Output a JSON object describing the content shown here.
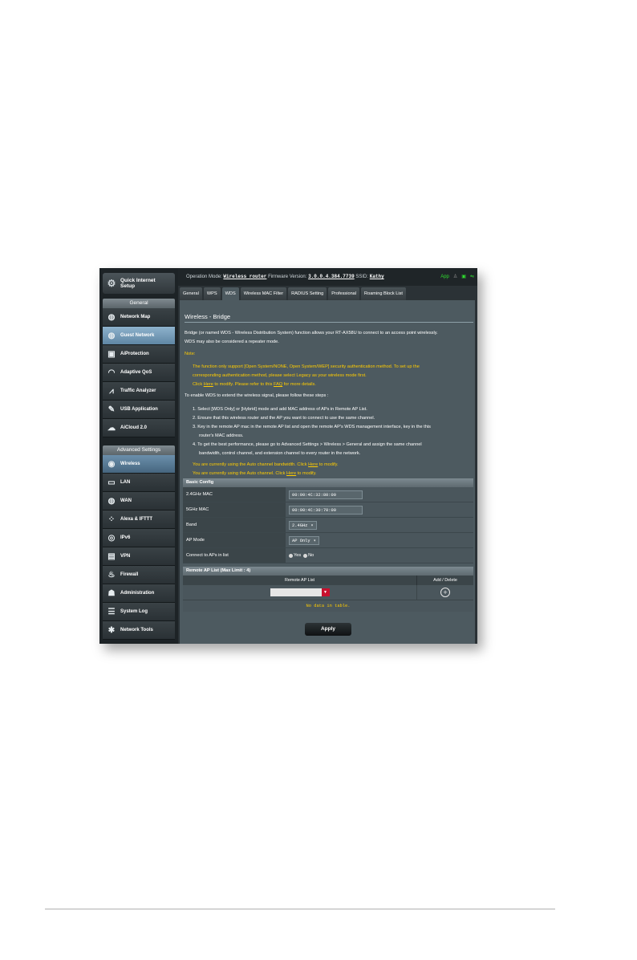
{
  "top_bar": {
    "operation_mode_label": "Operation Mode:",
    "operation_mode_value": "Wireless router",
    "firmware_label": "Firmware Version:",
    "firmware_value": "3.0.0.4.384.7739",
    "ssid_label": "SSID:",
    "ssid_value": "Kathy",
    "app_label": "App"
  },
  "sidebar": {
    "quick_setup": "Quick Internet Setup",
    "general_header": "General",
    "general_items": [
      "Network Map",
      "Guest Network",
      "AiProtection",
      "Adaptive QoS",
      "Traffic Analyzer",
      "USB Application",
      "AiCloud 2.0"
    ],
    "advanced_header": "Advanced Settings",
    "advanced_items": [
      "Wireless",
      "LAN",
      "WAN",
      "Alexa & IFTTT",
      "IPv6",
      "VPN",
      "Firewall",
      "Administration",
      "System Log",
      "Network Tools"
    ]
  },
  "tabs": [
    "General",
    "WPS",
    "WDS",
    "Wireless MAC Filter",
    "RADIUS Setting",
    "Professional",
    "Roaming Block List"
  ],
  "page": {
    "title": "Wireless - Bridge",
    "intro_1": "Bridge (or named WDS - Wireless Distribution System) function allows your RT-AX58U to connect to an access point wirelessly.",
    "intro_2": "WDS may also be considered a repeater mode.",
    "note_label": "Note:",
    "note_1": "The function only support [Open System/NONE, Open System/WEP] security authentication method. To set up the",
    "note_2": "corresponding authentication method, please select Legacy as your wireless mode first.",
    "note_3a": "Click",
    "note_3_link1": "Here",
    "note_3b": "to modify. Please refer to this",
    "note_3_link2": "FAQ",
    "note_3c": "for more details.",
    "steps_intro": "To enable WDS to extend the wireless signal, please follow these steps :",
    "step_1": "1. Select [WDS Only] or [Hybrid] mode and add MAC address of APs in Remote AP List.",
    "step_2": "2. Ensure that this wireless router and the AP you want to connect to use the same channel.",
    "step_3a": "3. Key in the remote AP mac in the remote AP list and open the remote AP's WDS management interface, key in the this",
    "step_3b": "router's MAC address.",
    "step_4a": "4. To get the best performance, please go to Advanced Settings > Wireless > General and assign the same channel",
    "step_4b": "bandwidth, control channel, and extension channel to every router in the network.",
    "auto_bw_a": "You are currently using the Auto channel bandwidth. Click",
    "auto_bw_link": "Here",
    "auto_bw_b": "to modify.",
    "auto_ch_a": "You are currently using the Auto channel. Click",
    "auto_ch_link": "Here",
    "auto_ch_b": "to modify."
  },
  "basic_config": {
    "header": "Basic Config",
    "mac_24_label": "2.4GHz MAC",
    "mac_24_value": "00:90:4C:32:80:00",
    "mac_5_label": "5GHz MAC",
    "mac_5_value": "00:90:4C:30:70:00",
    "band_label": "Band",
    "band_value": "2.4GHz",
    "ap_mode_label": "AP Mode",
    "ap_mode_value": "AP Only",
    "connect_label": "Connect to APs in list",
    "yes_label": "Yes",
    "no_label": "No"
  },
  "remote_ap": {
    "header": "Remote AP List (Max Limit : 4)",
    "col_list": "Remote AP List",
    "col_action": "Add / Delete",
    "empty": "No data in table."
  },
  "apply_label": "Apply",
  "colors": {
    "accent_yellow": "#ffcc00",
    "selected_blue": "#8eb2cd",
    "panel_bg": "#4d5a60"
  }
}
